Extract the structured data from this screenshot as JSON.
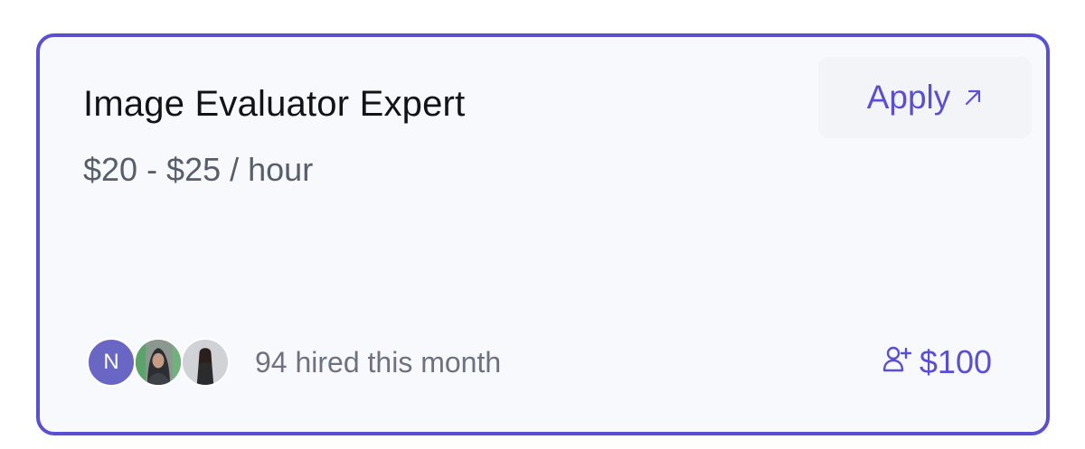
{
  "job": {
    "title": "Image Evaluator Expert",
    "rate": "$20 - $25 / hour",
    "apply_label": "Apply",
    "apply_icon": "arrow-up-right-icon"
  },
  "footer": {
    "avatars": [
      {
        "type": "initial",
        "label": "N",
        "color": "#6a66c4"
      },
      {
        "type": "photo",
        "icon": "user-photo"
      },
      {
        "type": "photo",
        "icon": "user-photo"
      }
    ],
    "hired_text": "94 hired this month",
    "referral_icon": "user-plus-icon",
    "referral_amount": "$100"
  },
  "colors": {
    "accent": "#5b4fd1",
    "card_background": "#f8f9fc",
    "title_text": "#111318",
    "muted_text": "#6c7280"
  }
}
